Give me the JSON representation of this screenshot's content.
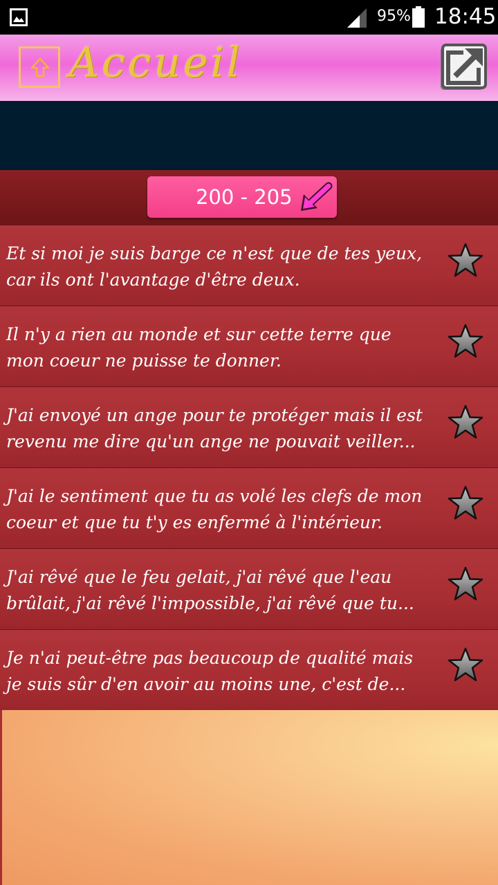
{
  "status_bar": {
    "battery_percent": "95%",
    "time": "18:45"
  },
  "action_bar": {
    "title": "Accueil"
  },
  "range": {
    "label": "200 - 205"
  },
  "quotes": [
    {
      "text": "Et si moi je suis barge ce n'est que de tes yeux, car ils ont l'avantage d'être deux."
    },
    {
      "text": "Il n'y a rien au monde et sur cette terre que mon coeur ne puisse te donner."
    },
    {
      "text": "J'ai envoyé un ange pour te protéger mais il est revenu me dire qu'un ange ne pouvait veiller..."
    },
    {
      "text": "J'ai le sentiment que tu as volé les clefs de mon coeur et que tu t'y es enfermé à l'intérieur."
    },
    {
      "text": "J'ai rêvé que le feu gelait, j'ai rêvé que l'eau brûlait, j'ai rêvé l'impossible, j'ai rêvé que tu..."
    },
    {
      "text": "Je n'ai peut-être pas beaucoup de qualité mais je suis sûr d'en avoir au moins une, c'est de..."
    }
  ],
  "icons": {
    "gallery": "gallery-icon",
    "signal": "signal-icon",
    "battery": "battery-icon",
    "home": "home-up-icon",
    "share": "share-icon",
    "range_arrow": "arrow-icon",
    "favorite": "star-icon"
  },
  "colors": {
    "action_bar": "#f06ad9",
    "title": "#e8c542",
    "banner": "#001c2e",
    "range_bar": "#7a1a1d",
    "range_button": "#ff4d96",
    "list_item": "#a82e33"
  }
}
